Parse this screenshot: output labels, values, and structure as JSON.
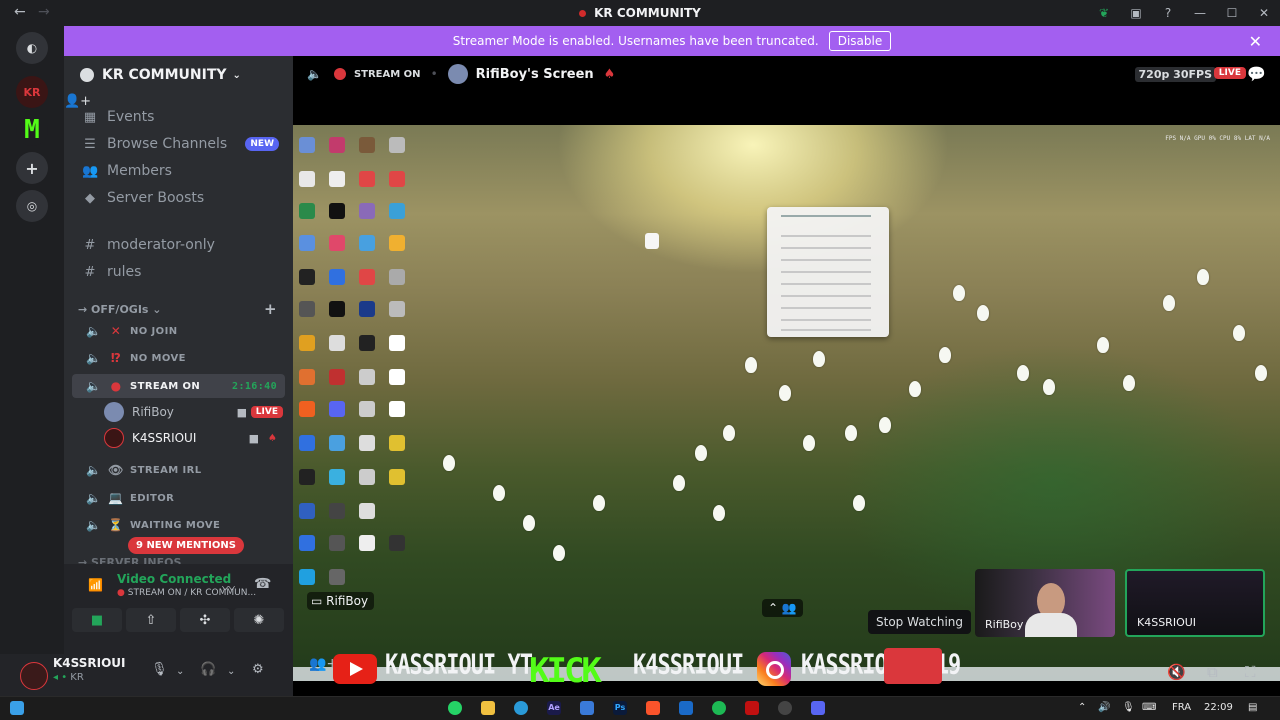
{
  "window": {
    "title": "KR COMMUNITY"
  },
  "banner": {
    "text": "Streamer Mode is enabled. Usernames have been truncated.",
    "button": "Disable"
  },
  "server": {
    "name": "KR COMMUNITY"
  },
  "nav": {
    "items": [
      {
        "label": "Events",
        "icon": "calendar-icon"
      },
      {
        "label": "Browse Channels",
        "icon": "browse-icon",
        "badge": "NEW"
      },
      {
        "label": "Members",
        "icon": "members-icon"
      },
      {
        "label": "Server Boosts",
        "icon": "boost-icon"
      },
      {
        "label": "moderator-only",
        "icon": "hash-icon"
      },
      {
        "label": "rules",
        "icon": "hash-icon"
      }
    ]
  },
  "category": {
    "label": "OFF/OGIs",
    "label2": "SERVER INFOS"
  },
  "voice_channels": [
    {
      "label": "NO JOIN",
      "emoji": "✕"
    },
    {
      "label": "NO MOVE",
      "emoji": "⁉"
    },
    {
      "label": "STREAM ON",
      "emoji": "●",
      "timer": "2:16:40"
    },
    {
      "label": "STREAM IRL",
      "emoji": "👁"
    },
    {
      "label": "EDITOR",
      "emoji": "💻"
    },
    {
      "label": "WAITING MOVE",
      "emoji": "⏳"
    }
  ],
  "voice_users": [
    {
      "name": "RifiBoy",
      "badge": "LIVE"
    },
    {
      "name": "K4SSRIOUI"
    }
  ],
  "mentions": "9 NEW MENTIONS",
  "voice_panel": {
    "status": "Video Connected",
    "sub": "STREAM ON / KR COMMUN..."
  },
  "user_panel": {
    "name": "K4SSRIOUI",
    "tag": "KR"
  },
  "stage": {
    "channel": "STREAM ON",
    "screen": "RifiBoy's Screen",
    "quality": "720p 30FPS",
    "live": "LIVE",
    "share_label": "RifiBoy",
    "stop_tooltip": "Stop Watching",
    "stats": "FPS N/A   GPU 0%   CPU 8%   LAT N/A"
  },
  "thumbs": [
    {
      "name": "RifiBoy"
    },
    {
      "name": "K4SSRIOUI"
    }
  ],
  "overlay": {
    "youtube": "KASSRIOUI YT",
    "kick_logo": "KICK",
    "kick": "K4SSRIOUI",
    "instagram": "KASSRIOUI.919"
  },
  "taskbar": {
    "lang": "FRA",
    "time": "22:09"
  },
  "colors": {
    "accent": "#5865f2",
    "banner": "#a35ff0",
    "live": "#da373c",
    "connected": "#23a55a"
  }
}
